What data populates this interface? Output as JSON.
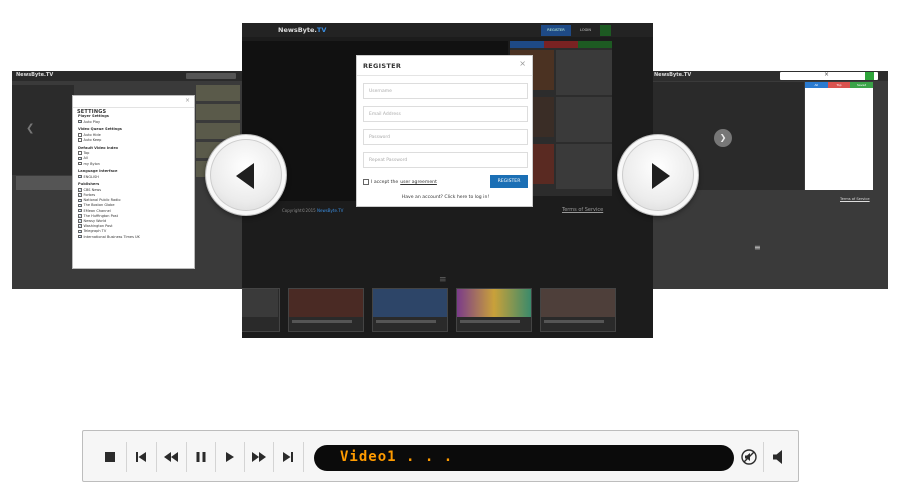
{
  "left_slide": {
    "logo": "NewsByte.TV",
    "settings": {
      "title": "SETTINGS",
      "close": "×",
      "sections": [
        {
          "title": "Player Settings",
          "options": [
            {
              "label": "Auto Play",
              "checked": true
            }
          ]
        },
        {
          "title": "Video Queue Settings",
          "options": [
            {
              "label": "Auto Hide",
              "checked": false
            },
            {
              "label": "Auto Keep",
              "checked": false
            }
          ]
        },
        {
          "title": "Default Video Index",
          "options": [
            {
              "label": "Top",
              "checked": false
            },
            {
              "label": "All",
              "checked": true
            },
            {
              "label": "my Bylon",
              "checked": false
            }
          ]
        },
        {
          "title": "Language Interface",
          "options": [
            {
              "label": "ENGLISH",
              "checked": true
            }
          ]
        },
        {
          "title": "Publishers",
          "options": [
            {
              "label": "CBS News",
              "checked": true
            },
            {
              "label": "Forbes",
              "checked": true
            },
            {
              "label": "National Public Radio",
              "checked": true
            },
            {
              "label": "The Boston Globe",
              "checked": true
            },
            {
              "label": "EMean Channel",
              "checked": true
            },
            {
              "label": "The Huffington Post",
              "checked": true
            },
            {
              "label": "Newsy World",
              "checked": true
            },
            {
              "label": "Washington Post",
              "checked": true
            },
            {
              "label": "Telegraph TV",
              "checked": true
            },
            {
              "label": "International Business Times UK",
              "checked": true
            }
          ]
        }
      ]
    }
  },
  "center_slide": {
    "logo_main": "NewsByte.",
    "logo_accent": "TV",
    "nav_register": "REGISTER",
    "nav_login": "LOGIN",
    "copyright_main": "Copyright©2015 ",
    "copyright_brand": "NewsByte.TV",
    "terms": "Terms of Service",
    "menu_glyph": "≡",
    "register": {
      "title": "REGISTER",
      "close": "×",
      "username_placeholder": "Username",
      "email_placeholder": "Email Address",
      "password_placeholder": "Password",
      "repeat_placeholder": "Repeat Password",
      "accept_prefix": "I accept the",
      "accept_link": "user agreement",
      "submit": "REGISTER",
      "have_account": "Have an account? Click here to log in!"
    }
  },
  "right_slide": {
    "logo": "NewsByte.TV",
    "search_clear": "×",
    "terms": "Terms of Service",
    "menu_glyph": "≡",
    "panel_tabs": [
      "All",
      "Top",
      "Saved"
    ]
  },
  "carousel": {
    "prev_icon": "chevron-left-icon",
    "next_icon": "chevron-right-icon"
  },
  "player": {
    "display_text": "Video1 . . .",
    "buttons": [
      "stop",
      "skip-back",
      "rewind",
      "pause",
      "play",
      "fast-forward",
      "skip-forward",
      "mute",
      "volume"
    ],
    "display_color": "#ff9b00"
  }
}
